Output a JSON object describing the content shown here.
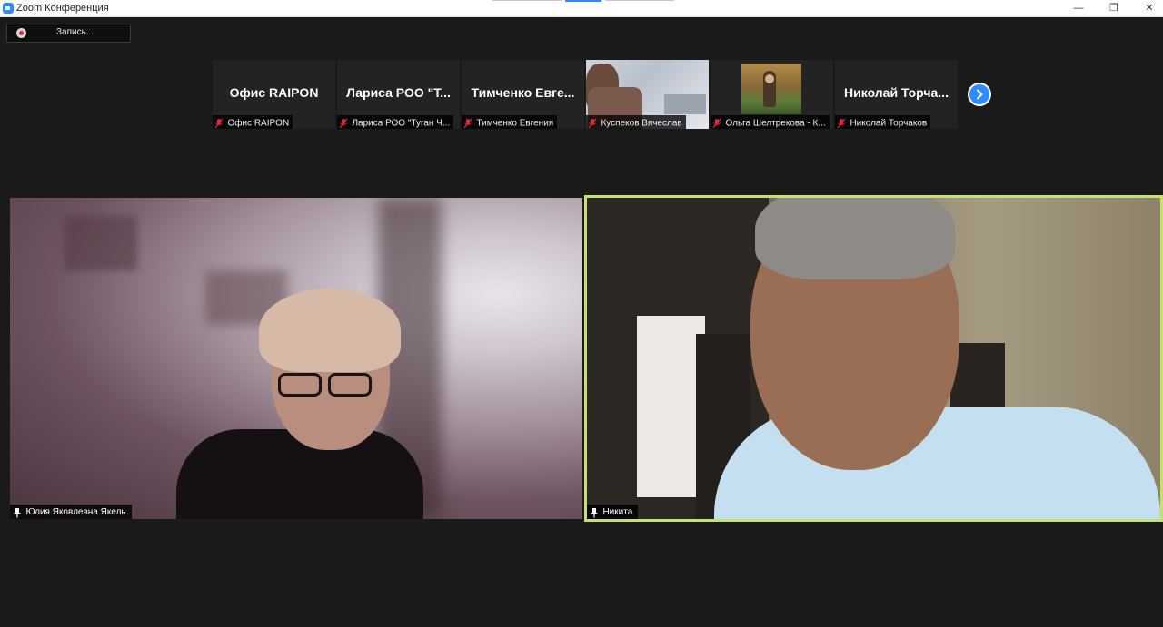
{
  "window": {
    "title": "Zoom Конференция",
    "controls": {
      "minimize": "—",
      "maximize": "❐",
      "close": "✕"
    }
  },
  "recording": {
    "label": "Запись...",
    "icon": "record-icon"
  },
  "thumbnails": [
    {
      "big_name": "Офис RAIPON",
      "caption": "Офис RAIPON",
      "has_video": false,
      "muted": true
    },
    {
      "big_name": "Лариса РОО \"Т...",
      "caption": "Лариса РОО \"Туган Ч...",
      "has_video": false,
      "muted": true
    },
    {
      "big_name": "Тимченко Евге...",
      "caption": "Тимченко Евгения",
      "has_video": false,
      "muted": true
    },
    {
      "big_name": "",
      "caption": "Куспеков Вячеслав",
      "has_video": true,
      "muted": true
    },
    {
      "big_name": "",
      "caption": "Ольга Шелтрекова - К...",
      "has_video": true,
      "muted": true
    },
    {
      "big_name": "Николай Торча...",
      "caption": "Николай Торчаков",
      "has_video": false,
      "muted": true
    }
  ],
  "next_page": {
    "icon": "chevron-right-icon"
  },
  "main_videos": [
    {
      "name": "Юлия Яковлевна Якель",
      "pinned": true
    },
    {
      "name": "Никита",
      "pinned": true,
      "active_speaker": true
    }
  ],
  "colors": {
    "accent": "#2d8cff",
    "speaker_border": "#c5e06b",
    "mute": "#e0283a",
    "background": "#1a1a1a"
  }
}
